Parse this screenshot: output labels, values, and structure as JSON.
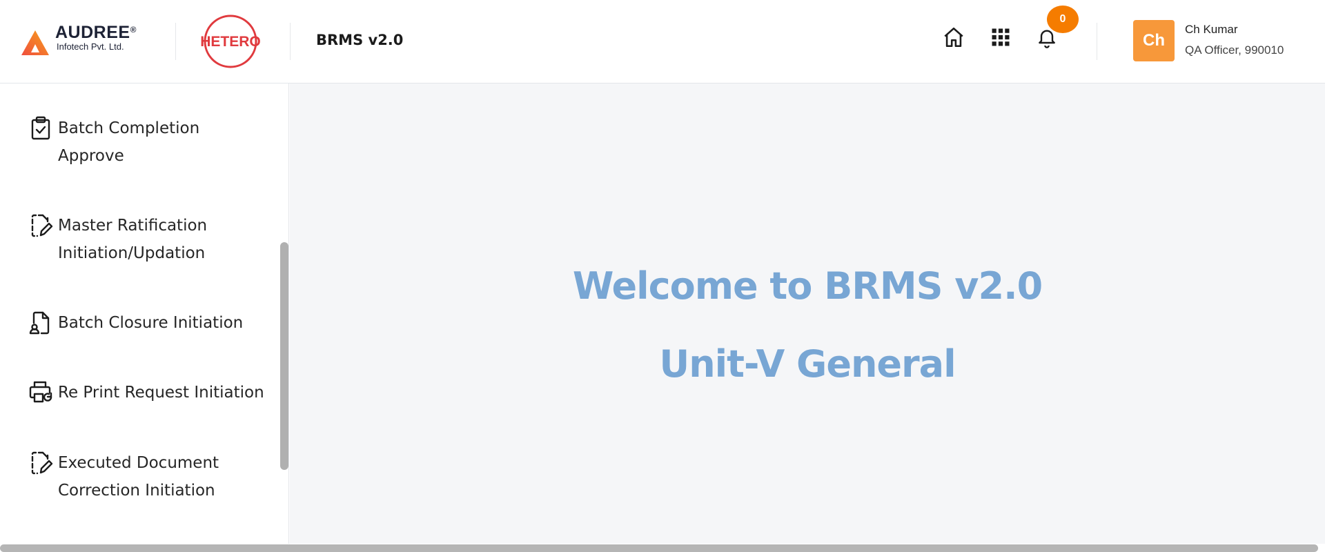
{
  "header": {
    "audree_logo": {
      "name": "AUDREE",
      "reg": "®",
      "subtitle": "Infotech Pvt. Ltd."
    },
    "hetero_logo": {
      "text": "HETERO"
    },
    "app_title": "BRMS v2.0",
    "icons": [
      "home-icon",
      "apps-grid-icon",
      "bell-icon"
    ],
    "notification_count": "0",
    "user": {
      "initials": "Ch",
      "name": "Ch Kumar",
      "role": "QA Officer, 990010"
    },
    "colors": {
      "accent": "#f57c00",
      "avatar": "#f7983a",
      "hetero_red": "#e03a3e"
    }
  },
  "sidebar": {
    "items": [
      {
        "label": "Batch Completion\nApprove",
        "icon": "clipboard-check-icon"
      },
      {
        "label": "Master Ratification\nInitiation/Updation",
        "icon": "document-edit-icon"
      },
      {
        "label": "Batch Closure Initiation",
        "icon": "file-user-icon"
      },
      {
        "label": "Re Print Request Initiation",
        "icon": "printer-refresh-icon"
      },
      {
        "label": "Executed Document\nCorrection Initiation",
        "icon": "document-edit-icon"
      }
    ]
  },
  "main": {
    "welcome_line1": "Welcome to BRMS v2.0",
    "welcome_line2": "Unit-V General",
    "text_color": "#78a6d4"
  }
}
